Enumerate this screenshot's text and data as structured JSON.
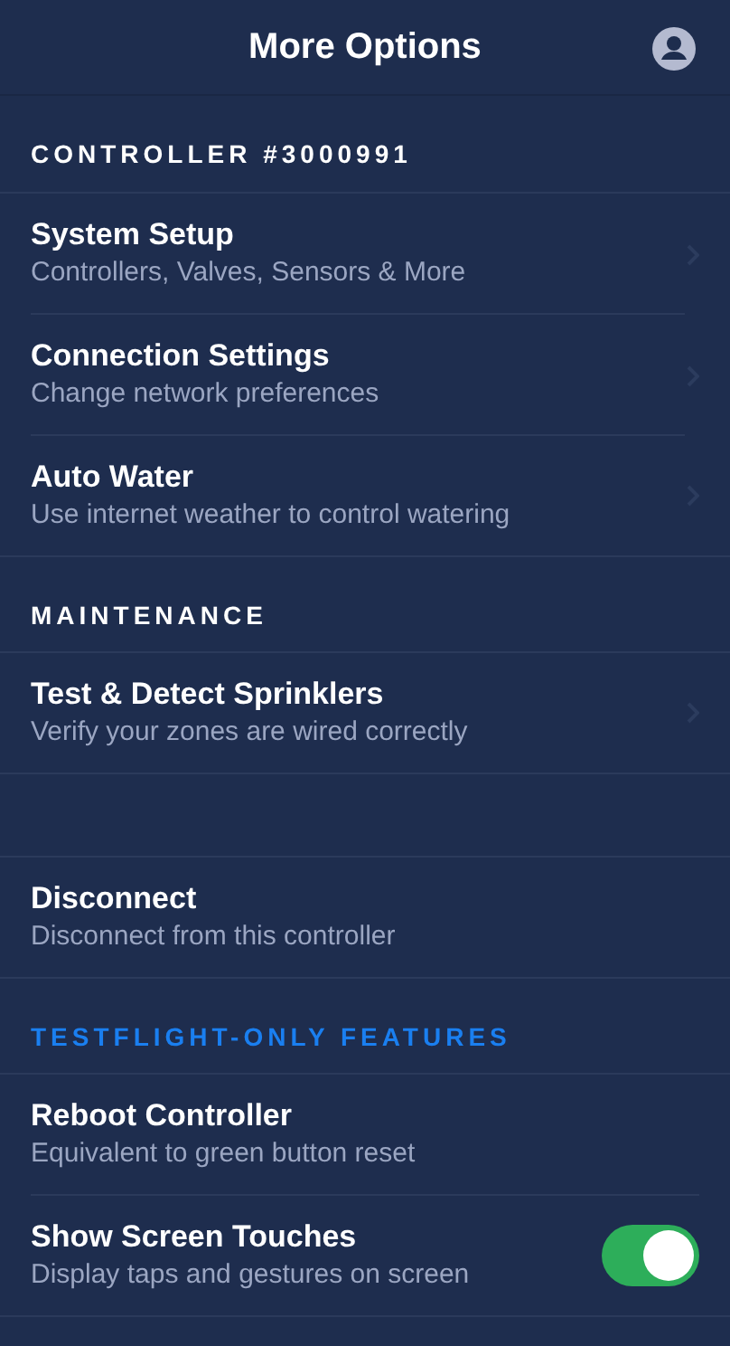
{
  "header": {
    "title": "More Options"
  },
  "sections": [
    {
      "heading": "CONTROLLER #3000991",
      "accent": false,
      "items": [
        {
          "kind": "link",
          "title": "System Setup",
          "subtitle": "Controllers, Valves, Sensors & More"
        },
        {
          "kind": "link",
          "title": "Connection Settings",
          "subtitle": "Change network preferences"
        },
        {
          "kind": "link",
          "title": "Auto Water",
          "subtitle": "Use internet weather to control watering"
        }
      ]
    },
    {
      "heading": "MAINTENANCE",
      "accent": false,
      "items": [
        {
          "kind": "link",
          "title": "Test & Detect Sprinklers",
          "subtitle": "Verify your zones are wired correctly"
        }
      ]
    },
    {
      "items": [
        {
          "kind": "action",
          "title": "Disconnect",
          "subtitle": "Disconnect from this controller"
        }
      ]
    },
    {
      "heading": "TESTFLIGHT-ONLY FEATURES",
      "accent": true,
      "items": [
        {
          "kind": "action",
          "title": "Reboot Controller",
          "subtitle": "Equivalent to green button reset"
        },
        {
          "kind": "toggle",
          "title": "Show Screen Touches",
          "subtitle": "Display taps and gestures on screen",
          "on": true
        }
      ]
    }
  ]
}
